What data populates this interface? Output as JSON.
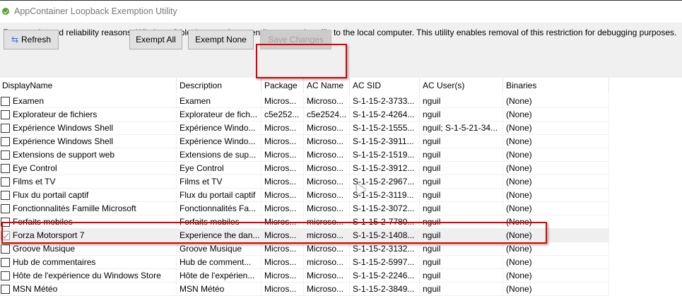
{
  "window": {
    "title": "AppContainer Loopback Exemption Utility"
  },
  "description": "For security and reliability reasons, Windows 8 blocks apps from sending network traffic to the local computer. This utility enables removal of this restriction for debugging purposes.",
  "toolbar": {
    "refresh": "Refresh",
    "exempt_all": "Exempt All",
    "exempt_none": "Exempt None",
    "save_changes": "Save Changes"
  },
  "columns": [
    "DisplayName",
    "Description",
    "Package",
    "AC Name",
    "AC SID",
    "AC User(s)",
    "Binaries"
  ],
  "rows": [
    {
      "checked": false,
      "cells": [
        "Examen",
        "Examen",
        "Micros...",
        "Microso...",
        "S-1-15-2-3733...",
        "nguil",
        "(None)"
      ]
    },
    {
      "checked": false,
      "cells": [
        "Explorateur de fichiers",
        "Explorateur de fich...",
        "c5e252...",
        "c5e2524...",
        "S-1-15-2-4264...",
        "nguil",
        "(None)"
      ]
    },
    {
      "checked": false,
      "cells": [
        "Expérience Windows Shell",
        "Expérience Windo...",
        "Micros...",
        "Microso...",
        "S-1-15-2-1555...",
        "nguil; S-1-5-21-34...",
        "(None)"
      ]
    },
    {
      "checked": false,
      "cells": [
        "Expérience Windows Shell",
        "Expérience Windo...",
        "Micros...",
        "Microso...",
        "S-1-15-2-3911...",
        "nguil",
        "(None)"
      ]
    },
    {
      "checked": false,
      "cells": [
        "Extensions de support web",
        "Extensions de sup...",
        "Micros...",
        "Microso...",
        "S-1-15-2-1519...",
        "nguil",
        "(None)"
      ]
    },
    {
      "checked": false,
      "cells": [
        "Eye Control",
        "Eye Control",
        "Micros...",
        "Microso...",
        "S-1-15-2-3912...",
        "nguil",
        "(None)"
      ]
    },
    {
      "checked": false,
      "cells": [
        "Films et TV",
        "Films et TV",
        "Micros...",
        "Microso...",
        "S-1-15-2-2967...",
        "nguil",
        "(None)"
      ]
    },
    {
      "checked": false,
      "cells": [
        "Flux du portail captif",
        "Flux du portail captif",
        "Micros...",
        "Microso...",
        "S-1-15-2-3119...",
        "nguil",
        "(None)"
      ]
    },
    {
      "checked": false,
      "cells": [
        "Fonctionnalités Famille Microsoft",
        "Fonctionnalités Fa...",
        "Micros...",
        "Microso...",
        "S-1-15-2-3072...",
        "nguil",
        "(None)"
      ]
    },
    {
      "checked": false,
      "cells": [
        "Forfaits mobiles",
        "Forfaits mobiles",
        "Micros...",
        "microso...",
        "S-1-15-2-7780...",
        "nguil",
        "(None)"
      ]
    },
    {
      "checked": true,
      "selected": true,
      "cells": [
        "Forza Motorsport 7",
        "Experience the dan...",
        "Micros...",
        "microso...",
        "S-1-15-2-1408...",
        "nguil",
        "(None)"
      ]
    },
    {
      "checked": false,
      "cells": [
        "Groove Musique",
        "Groove Musique",
        "Micros...",
        "Microso...",
        "S-1-15-2-3132...",
        "nguil",
        "(None)"
      ]
    },
    {
      "checked": false,
      "cells": [
        "Hub de commentaires",
        "Hub de comment...",
        "Micros...",
        "microso...",
        "S-1-15-2-5997...",
        "nguil",
        "(None)"
      ]
    },
    {
      "checked": false,
      "cells": [
        "Hôte de l'expérience du Windows Store",
        "Hôte de l'expérien...",
        "Micros...",
        "Microso...",
        "S-1-15-2-2246...",
        "nguil",
        "(None)"
      ]
    },
    {
      "checked": false,
      "cells": [
        "MSN Météo",
        "MSN Météo",
        "Micros...",
        "Microso...",
        "S-1-15-2-3849...",
        "nguil",
        "(None)"
      ]
    }
  ]
}
